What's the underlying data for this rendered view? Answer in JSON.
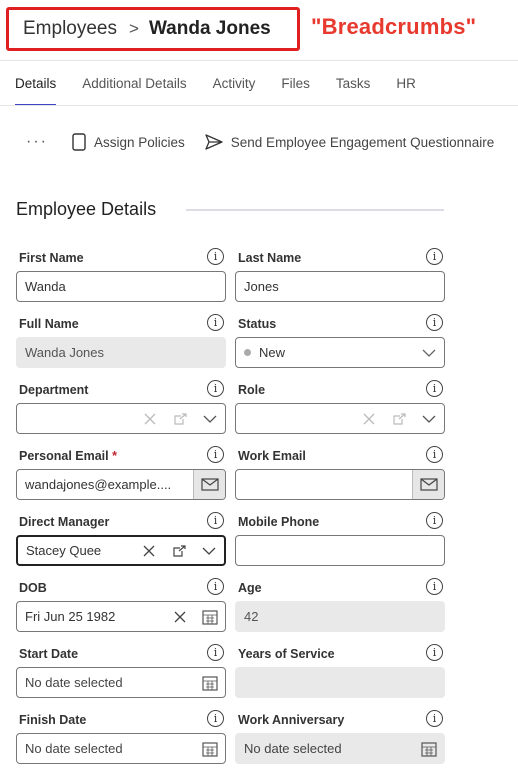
{
  "breadcrumb": {
    "parent": "Employees",
    "separator": ">",
    "current": "Wanda Jones"
  },
  "annotation": "\"Breadcrumbs\"",
  "tabs": [
    {
      "label": "Details"
    },
    {
      "label": "Additional Details"
    },
    {
      "label": "Activity"
    },
    {
      "label": "Files"
    },
    {
      "label": "Tasks"
    },
    {
      "label": "HR"
    }
  ],
  "actions": {
    "more": "···",
    "assign_policies": "Assign Policies",
    "send_questionnaire": "Send Employee Engagement Questionnaire"
  },
  "section": {
    "title": "Employee Details"
  },
  "fields": {
    "first_name": {
      "label": "First Name",
      "value": "Wanda"
    },
    "last_name": {
      "label": "Last Name",
      "value": "Jones"
    },
    "full_name": {
      "label": "Full Name",
      "value": "Wanda Jones"
    },
    "status": {
      "label": "Status",
      "value": "New"
    },
    "department": {
      "label": "Department",
      "value": ""
    },
    "role": {
      "label": "Role",
      "value": ""
    },
    "personal_email": {
      "label": "Personal Email",
      "required_mark": "*",
      "value": "wandajones@example...."
    },
    "work_email": {
      "label": "Work Email",
      "value": ""
    },
    "direct_manager": {
      "label": "Direct Manager",
      "value": "Stacey Quee"
    },
    "mobile_phone": {
      "label": "Mobile Phone",
      "value": ""
    },
    "dob": {
      "label": "DOB",
      "value": "Fri Jun 25 1982"
    },
    "age": {
      "label": "Age",
      "value": "42"
    },
    "start_date": {
      "label": "Start Date",
      "placeholder": "No date selected"
    },
    "years_of_service": {
      "label": "Years of Service",
      "value": ""
    },
    "finish_date": {
      "label": "Finish Date",
      "placeholder": "No date selected"
    },
    "work_anniversary": {
      "label": "Work Anniversary",
      "placeholder": "No date selected"
    }
  },
  "info_icon_glyph": "i",
  "colors": {
    "accent": "#3c47c7",
    "annotation": "#e8392e",
    "required": "#c0262f",
    "disabled_bg": "#e9e9e9"
  }
}
